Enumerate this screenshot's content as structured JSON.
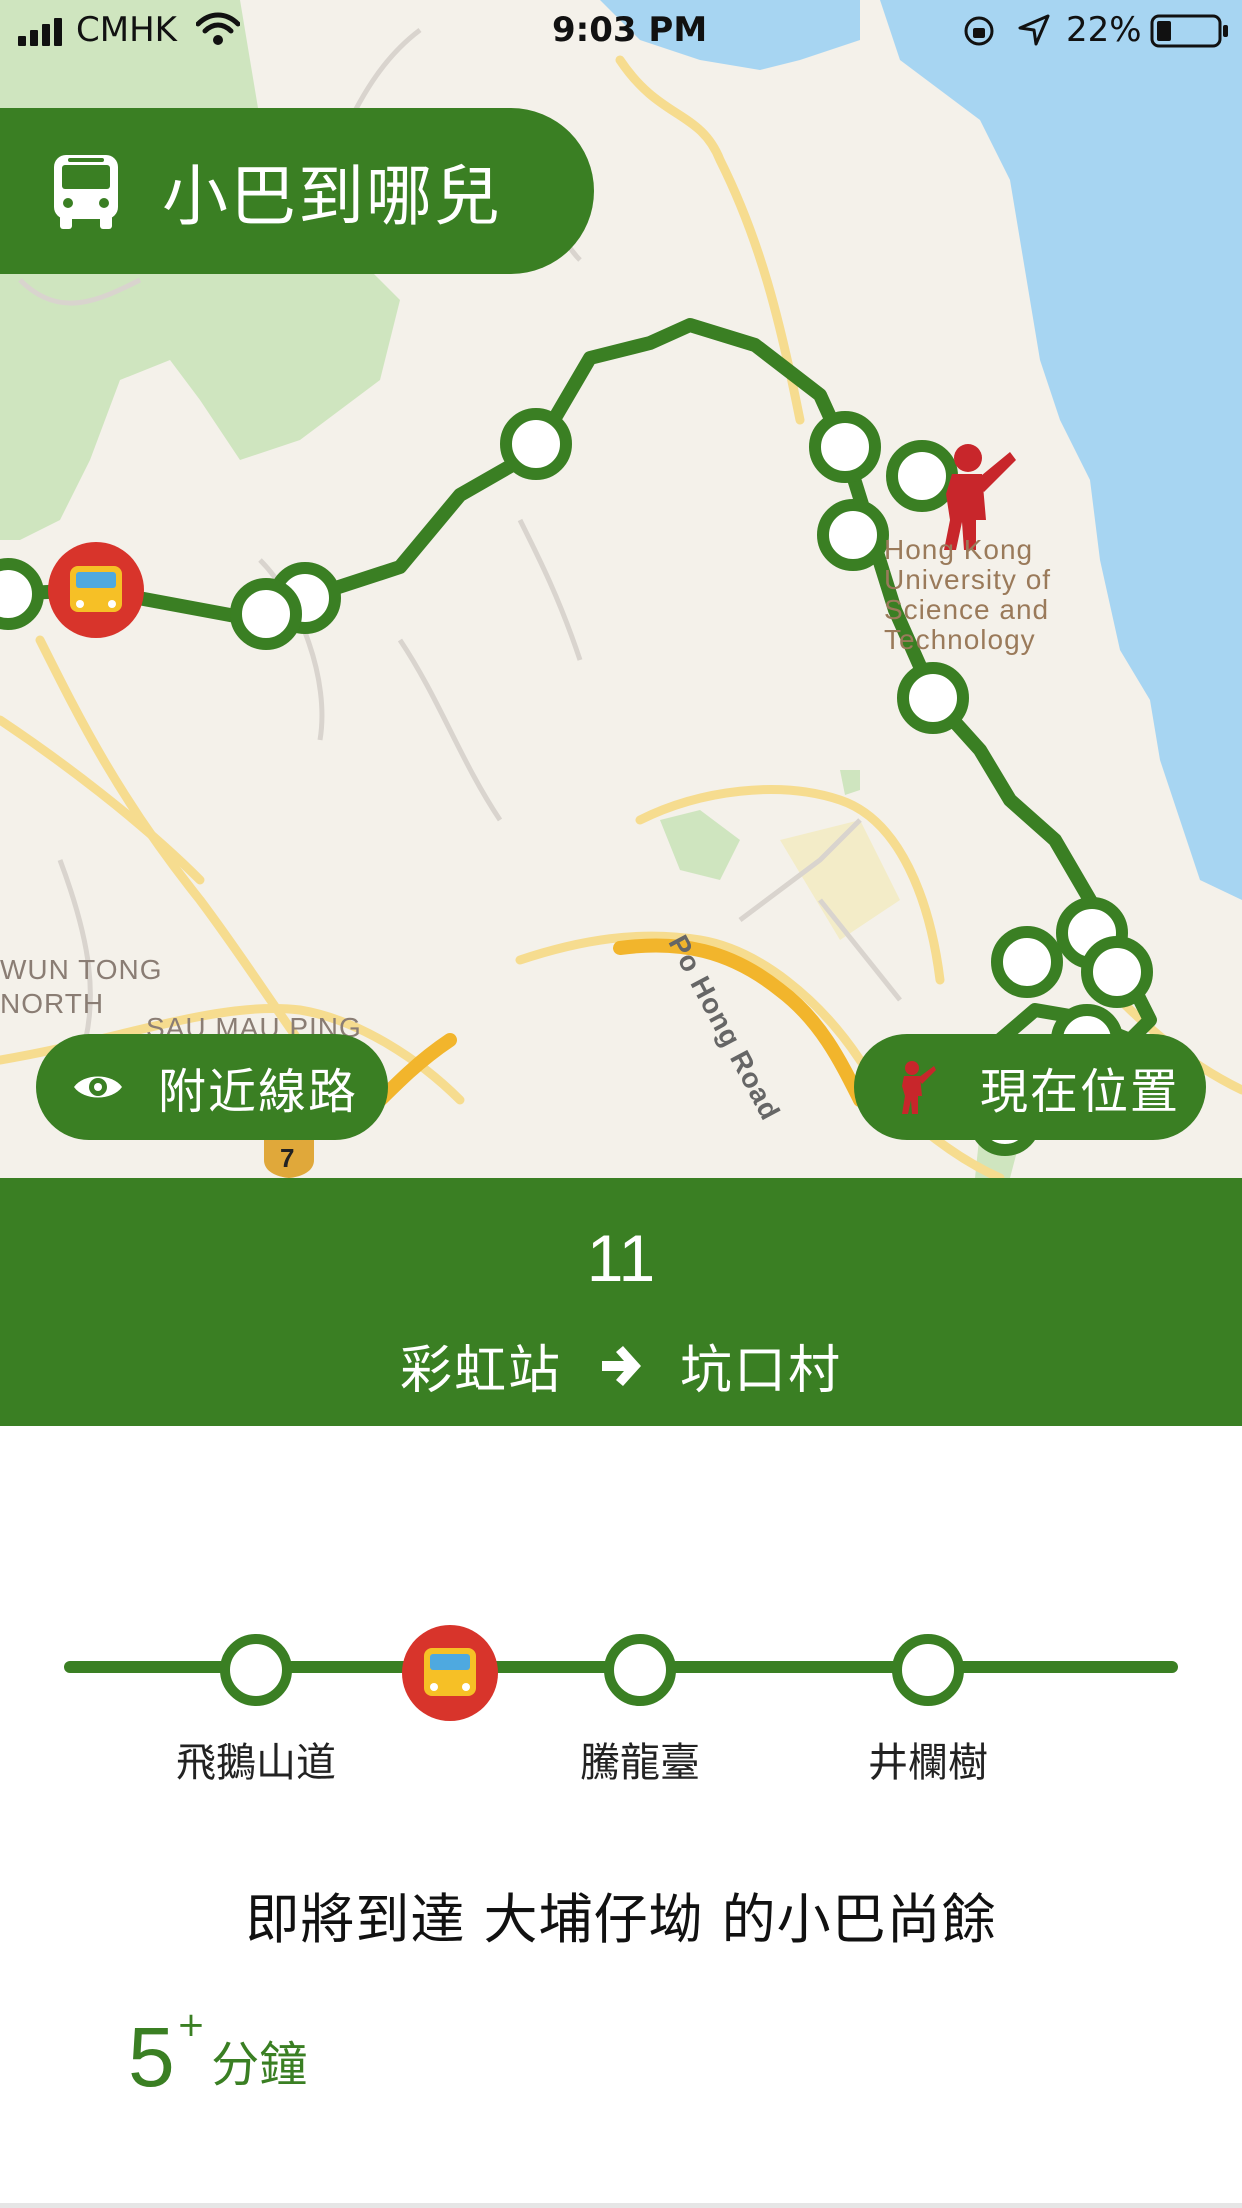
{
  "status_bar": {
    "carrier": "CMHK",
    "time": "9:03 PM",
    "battery": "22%"
  },
  "app": {
    "title": "小巴到哪兒",
    "title_icon": "bus-icon",
    "accent_color": "#3a7f23"
  },
  "map": {
    "labels": {
      "university": [
        "Hong Kong",
        "University of",
        "Science and",
        "Technology"
      ],
      "po_hong_road": "Po Hong Road",
      "kwun_tong_north": [
        "WUN TONG",
        "NORTH"
      ],
      "sau_mau_ping": "SAU MAU PING",
      "route_shield": "7"
    },
    "buttons": {
      "nearby": {
        "label": "附近線路",
        "icon": "eye-icon"
      },
      "location": {
        "label": "現在位置",
        "icon": "person-pointing-icon"
      }
    }
  },
  "route": {
    "number": "11",
    "from": "彩虹站",
    "to": "坑口村"
  },
  "timeline": {
    "stops": [
      {
        "label": "飛鵝山道"
      },
      {
        "label": ""
      },
      {
        "label": "騰龍臺"
      },
      {
        "label": "井欄樹"
      }
    ]
  },
  "eta": {
    "message": "即將到達 大埔仔坳 的小巴尚餘",
    "value": "5",
    "suffix": "+",
    "unit": "分鐘"
  }
}
